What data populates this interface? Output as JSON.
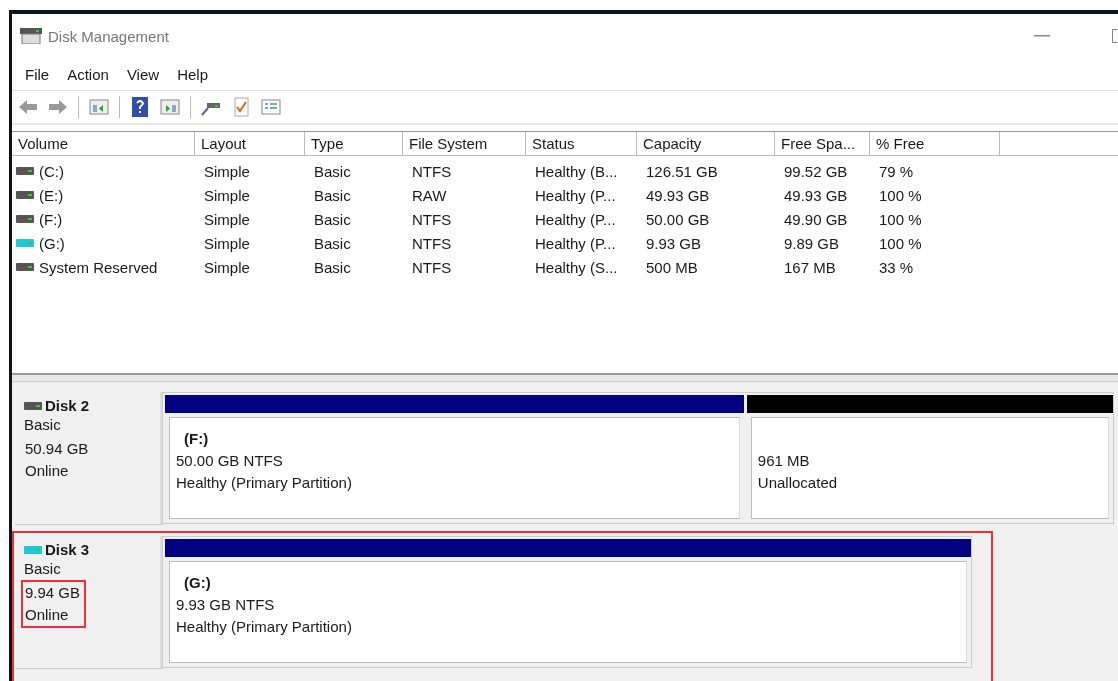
{
  "window": {
    "title": "Disk Management"
  },
  "menu": [
    "File",
    "Action",
    "View",
    "Help"
  ],
  "table": {
    "columns": [
      "Volume",
      "Layout",
      "Type",
      "File System",
      "Status",
      "Capacity",
      "Free Spa...",
      "% Free"
    ],
    "rows": [
      {
        "color": "#555555",
        "cells": [
          "(C:)",
          "Simple",
          "Basic",
          "NTFS",
          "Healthy (B...",
          "126.51 GB",
          "99.52 GB",
          "79 %"
        ]
      },
      {
        "color": "#555555",
        "cells": [
          "(E:)",
          "Simple",
          "Basic",
          "RAW",
          "Healthy (P...",
          "49.93 GB",
          "49.93 GB",
          "100 %"
        ]
      },
      {
        "color": "#555555",
        "cells": [
          "(F:)",
          "Simple",
          "Basic",
          "NTFS",
          "Healthy (P...",
          "50.00 GB",
          "49.90 GB",
          "100 %"
        ]
      },
      {
        "color": "#1ec8d8",
        "cells": [
          "(G:)",
          "Simple",
          "Basic",
          "NTFS",
          "Healthy (P...",
          "9.93 GB",
          "9.89 GB",
          "100 %"
        ]
      },
      {
        "color": "#555555",
        "cells": [
          "System Reserved",
          "Simple",
          "Basic",
          "NTFS",
          "Healthy (S...",
          "500 MB",
          "167 MB",
          "33 %"
        ]
      }
    ]
  },
  "disks": [
    {
      "name": "Disk 2",
      "type": "Basic",
      "size": "50.94 GB",
      "status": "Online",
      "color": "#555555",
      "highlighted": false,
      "details_highlighted": false,
      "partitions": [
        {
          "kind": "primary",
          "label": "(F:)",
          "size": "50.00 GB NTFS",
          "status": "Healthy (Primary Partition)"
        },
        {
          "kind": "unallocated",
          "size": "961 MB",
          "status": "Unallocated"
        }
      ]
    },
    {
      "name": "Disk 3",
      "type": "Basic",
      "size": "9.94 GB",
      "status": "Online",
      "color": "#1ec8d8",
      "highlighted": true,
      "details_highlighted": true,
      "partitions": [
        {
          "kind": "primary",
          "label": "(G:)",
          "size": "9.93 GB NTFS",
          "status": "Healthy (Primary Partition)"
        }
      ]
    }
  ]
}
